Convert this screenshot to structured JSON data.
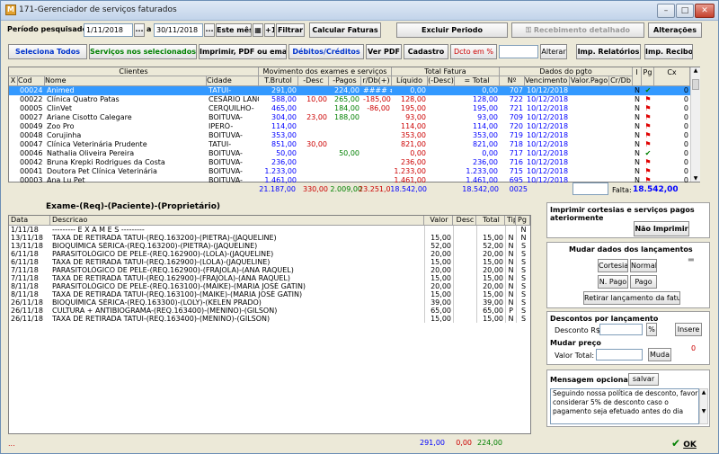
{
  "window": {
    "title": "171-Gerenciador de serviços faturados",
    "icon_letter": "M"
  },
  "filter": {
    "periodo_label": "Período pesquisado:",
    "date_from": "1/11/2018",
    "sep": "a",
    "date_to": "30/11/2018",
    "ellipsis": "...",
    "este_mes": "Este mês",
    "plus1": "+1",
    "filtrar": "Filtrar"
  },
  "toolbar1": {
    "calcular": "Calcular Faturas",
    "excluir": "Excluir Periodo",
    "recebimento": "Recebimento detalhado",
    "alteracoes": "Alterações"
  },
  "toolbar2": {
    "sel_todos": "Seleciona Todos",
    "servicos_nao": "Serviços nos selecionados:",
    "imprimir": "Imprimir, PDF ou email",
    "debitos": "Débitos/Créditos",
    "ver_pdf": "Ver PDF",
    "cadastro": "Cadastro",
    "desc_em": "Dcto em %",
    "alterar": "Alterar",
    "relatorios": "Imp. Relatórios",
    "recibo": "Imp. Recibo"
  },
  "grid": {
    "groups": {
      "clientes": "Clientes",
      "movimento": "Movimento dos exames e serviços",
      "fatura": "Total Fatura",
      "pgto": "Dados do pgto"
    },
    "columns": {
      "x": "X",
      "cod": "Cod",
      "nome": "Nome",
      "cidade": "Cidade",
      "tbruto": "T.Brutol",
      "desc": "-Desc",
      "pagos": "-Pagos",
      "rdb": "r/Db(+)",
      "liquido": "Líquido",
      "ldesc": "(-Desc)",
      "total": "= Total",
      "num": "Nº",
      "venc": "Vencimento",
      "vpago": "Valor.Pago",
      "crdb": "Cr/Db",
      "i": "I",
      "pg": "Pg",
      "cx": "Cx"
    },
    "rows": [
      {
        "cod": "00024",
        "nome": "Animed",
        "cidade": "TATUI-",
        "tbruto": "291,00",
        "desc": "",
        "pagos": "224,00",
        "rdb": "#### ##",
        "liquido": "0,00",
        "ldesc": "",
        "total": "0,00",
        "num": "707",
        "venc": "10/12/2018",
        "i": "N",
        "pg": "check",
        "cx": "0",
        "selected": true
      },
      {
        "cod": "00022",
        "nome": "Clínica Quatro Patas",
        "cidade": "CESÁRIO LANG",
        "tbruto": "588,00",
        "desc": "10,00",
        "pagos": "265,00",
        "rdb": "-185,00",
        "liquido": "128,00",
        "ldesc": "",
        "total": "128,00",
        "num": "722",
        "venc": "10/12/2018",
        "i": "N",
        "pg": "flag",
        "cx": "0"
      },
      {
        "cod": "00005",
        "nome": "ClinVet",
        "cidade": "CERQUILHO-",
        "tbruto": "465,00",
        "desc": "",
        "pagos": "184,00",
        "rdb": "-86,00",
        "liquido": "195,00",
        "ldesc": "",
        "total": "195,00",
        "num": "721",
        "venc": "10/12/2018",
        "i": "N",
        "pg": "flag",
        "cx": "0"
      },
      {
        "cod": "00027",
        "nome": "Ariane Cisotto Calegare",
        "cidade": "BOITUVA-",
        "tbruto": "304,00",
        "desc": "23,00",
        "pagos": "188,00",
        "rdb": "",
        "liquido": "93,00",
        "ldesc": "",
        "total": "93,00",
        "num": "709",
        "venc": "10/12/2018",
        "i": "N",
        "pg": "flag",
        "cx": "0"
      },
      {
        "cod": "00049",
        "nome": "Zoo Pro",
        "cidade": "IPERÓ-",
        "tbruto": "114,00",
        "desc": "",
        "pagos": "",
        "rdb": "",
        "liquido": "114,00",
        "ldesc": "",
        "total": "114,00",
        "num": "720",
        "venc": "10/12/2018",
        "i": "N",
        "pg": "flag",
        "cx": "0"
      },
      {
        "cod": "00048",
        "nome": "Corujinha",
        "cidade": "BOITUVA-",
        "tbruto": "353,00",
        "desc": "",
        "pagos": "",
        "rdb": "",
        "liquido": "353,00",
        "ldesc": "",
        "total": "353,00",
        "num": "719",
        "venc": "10/12/2018",
        "i": "N",
        "pg": "flag",
        "cx": "0"
      },
      {
        "cod": "00047",
        "nome": "Clínica Veterinária Prudente",
        "cidade": "TATUI-",
        "tbruto": "851,00",
        "desc": "30,00",
        "pagos": "",
        "rdb": "",
        "liquido": "821,00",
        "ldesc": "",
        "total": "821,00",
        "num": "718",
        "venc": "10/12/2018",
        "i": "N",
        "pg": "flag",
        "cx": "0"
      },
      {
        "cod": "00046",
        "nome": "Nathalia Oliveira Pereira",
        "cidade": "BOITUVA-",
        "tbruto": "50,00",
        "desc": "",
        "pagos": "50,00",
        "rdb": "",
        "liquido": "0,00",
        "ldesc": "",
        "total": "0,00",
        "num": "717",
        "venc": "10/12/2018",
        "i": "N",
        "pg": "check",
        "cx": "0"
      },
      {
        "cod": "00042",
        "nome": "Bruna Krepki Rodrigues da Costa",
        "cidade": "BOITUVA-",
        "tbruto": "236,00",
        "desc": "",
        "pagos": "",
        "rdb": "",
        "liquido": "236,00",
        "ldesc": "",
        "total": "236,00",
        "num": "716",
        "venc": "10/12/2018",
        "i": "N",
        "pg": "flag",
        "cx": "0"
      },
      {
        "cod": "00041",
        "nome": "Doutora Pet Clínica Veterinária",
        "cidade": "BOITUVA-",
        "tbruto": "1.233,00",
        "desc": "",
        "pagos": "",
        "rdb": "",
        "liquido": "1.233,00",
        "ldesc": "",
        "total": "1.233,00",
        "num": "715",
        "venc": "10/12/2018",
        "i": "N",
        "pg": "flag",
        "cx": "0"
      },
      {
        "cod": "00003",
        "nome": "Ana Lu Pet",
        "cidade": "BOITUVA-",
        "tbruto": "1.461,00",
        "desc": "",
        "pagos": "",
        "rdb": "",
        "liquido": "1.461,00",
        "ldesc": "",
        "total": "1.461,00",
        "num": "695",
        "venc": "10/12/2018",
        "i": "N",
        "pg": "flag",
        "cx": "0"
      }
    ],
    "totals": {
      "tbruto": "21.187,00",
      "desc": "330,00",
      "pagos": "2.009,00",
      "rdb": "23.251,00",
      "liquido": "18.542,00",
      "total": "18.542,00",
      "num": "0025",
      "falta_label": "Falta:",
      "falta": "18.542,00"
    }
  },
  "exame": {
    "title": "Exame-(Req)-(Paciente)-(Proprietário)",
    "columns": {
      "data": "Data",
      "descricao": "Descricao",
      "valor": "Valor",
      "desc": "Desc",
      "total": "Total",
      "tip": "Tip",
      "pg": "Pg"
    },
    "rows": [
      {
        "data": "1/11/18",
        "descricao": "--------- E X A M E S ---------",
        "valor": "",
        "desc": "",
        "total": "",
        "tip": "",
        "pg": "N"
      },
      {
        "data": "13/11/18",
        "descricao": "TAXA DE RETIRADA TATUI-(REQ.163200)-(PIETRA)-(JAQUELINE)",
        "valor": "15,00",
        "desc": "",
        "total": "15,00",
        "tip": "N",
        "pg": "N"
      },
      {
        "data": "13/11/18",
        "descricao": "BIOQUÍMICA SÉRICA-(REQ.163200)-(PIETRA)-(JAQUELINE)",
        "valor": "52,00",
        "desc": "",
        "total": "52,00",
        "tip": "N",
        "pg": "S"
      },
      {
        "data": "6/11/18",
        "descricao": "PARASITOLÓGICO DE PELE-(REQ.162900)-(LOLA)-(JAQUELINE)",
        "valor": "20,00",
        "desc": "",
        "total": "20,00",
        "tip": "N",
        "pg": "S"
      },
      {
        "data": "6/11/18",
        "descricao": "TAXA DE RETIRADA TATUI-(REQ.162900)-(LOLA)-(JAQUELINE)",
        "valor": "15,00",
        "desc": "",
        "total": "15,00",
        "tip": "N",
        "pg": "S"
      },
      {
        "data": "7/11/18",
        "descricao": "PARASITOLÓGICO DE PELE-(REQ.162900)-(FRAJOLA)-(ANA RAQUEL)",
        "valor": "20,00",
        "desc": "",
        "total": "20,00",
        "tip": "N",
        "pg": "S"
      },
      {
        "data": "7/11/18",
        "descricao": "TAXA DE RETIRADA TATUI-(REQ.162900)-(FRAJOLA)-(ANA RAQUEL)",
        "valor": "15,00",
        "desc": "",
        "total": "15,00",
        "tip": "N",
        "pg": "S"
      },
      {
        "data": "8/11/18",
        "descricao": "PARASITOLÓGICO DE PELE-(REQ.163100)-(MAIKE)-(MARIA JOSÉ GATIN)",
        "valor": "20,00",
        "desc": "",
        "total": "20,00",
        "tip": "N",
        "pg": "S"
      },
      {
        "data": "8/11/18",
        "descricao": "TAXA DE RETIRADA TATUI-(REQ.163100)-(MAIKE)-(MARIA JOSÉ GATIN)",
        "valor": "15,00",
        "desc": "",
        "total": "15,00",
        "tip": "N",
        "pg": "S"
      },
      {
        "data": "26/11/18",
        "descricao": "BIOQUÍMICA SÉRICA-(REQ.163300)-(LOLY)-(KELEN PRADO)",
        "valor": "39,00",
        "desc": "",
        "total": "39,00",
        "tip": "N",
        "pg": "S"
      },
      {
        "data": "26/11/18",
        "descricao": "CULTURA + ANTIBIOGRAMA-(REQ.163400)-(MENINO)-(GILSON)",
        "valor": "65,00",
        "desc": "",
        "total": "65,00",
        "tip": "P",
        "pg": "S"
      },
      {
        "data": "26/11/18",
        "descricao": "TAXA DE RETIRADA TATUI-(REQ.163400)-(MENINO)-(GILSON)",
        "valor": "15,00",
        "desc": "",
        "total": "15,00",
        "tip": "N",
        "pg": "S"
      }
    ],
    "footer": {
      "dots": "...",
      "valor": "291,00",
      "desc": "0,00",
      "total": "224,00"
    }
  },
  "right": {
    "imprimir_title": "Imprimir cortesias e serviços pagos ateriormente",
    "nao_imprimir": "Não Imprimir",
    "mudar_dados": "Mudar dados dos lançamentos",
    "cortesia": "Cortesia",
    "normal": "Normal",
    "npago": "N. Pago",
    "pago": "Pago",
    "retirar": "Retirar lançamento da fatura",
    "descontos_title": "Descontos por lançamento",
    "desconto_label": "Desconto R$:",
    "pct": "%",
    "insere": "Insere",
    "mudar_preco": "Mudar preço",
    "valor_total": "Valor Total:",
    "muda": "Muda",
    "zero": "0",
    "msg_title": "Mensagem opcional",
    "salvar": "salvar",
    "msg_text": "Seguindo nossa política de desconto, favor considerar 5% de desconto caso o pagamento seja efetuado antes do dia"
  },
  "ok": "OK",
  "colors": {
    "blue": "#0000ff",
    "red": "#ff0000",
    "green": "#008000",
    "select": "#3399ff"
  }
}
